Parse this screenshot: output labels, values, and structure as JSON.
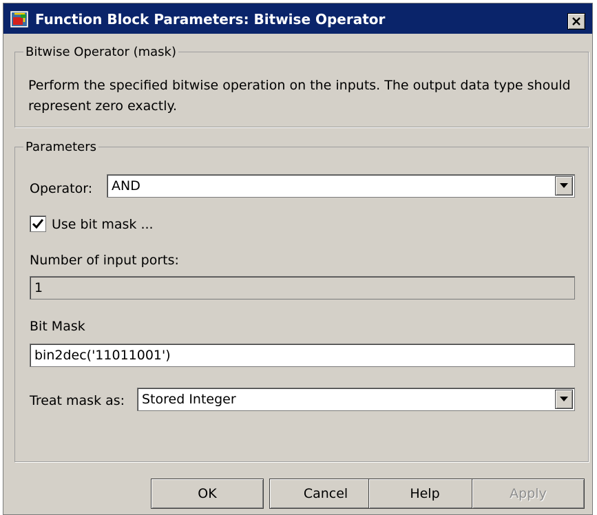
{
  "window": {
    "title": "Function Block Parameters: Bitwise Operator",
    "close_icon": "close-icon"
  },
  "mask_group": {
    "legend": "Bitwise Operator (mask)",
    "description": "Perform the specified bitwise operation on the inputs. The output data type should represent zero exactly."
  },
  "params_group": {
    "legend": "Parameters",
    "operator": {
      "label": "Operator:",
      "value": "AND"
    },
    "use_bit_mask": {
      "label": "Use bit mask ...",
      "checked": true
    },
    "num_inputs": {
      "label": "Number of input ports:",
      "value": "1"
    },
    "bit_mask": {
      "label": "Bit Mask",
      "value": "bin2dec('11011001')"
    },
    "treat_mask": {
      "label": "Treat mask as:",
      "value": "Stored Integer"
    }
  },
  "buttons": {
    "ok": "OK",
    "cancel": "Cancel",
    "help": "Help",
    "apply": "Apply"
  },
  "colors": {
    "titlebar": "#0a246a",
    "dialog_bg": "#d4d0c8",
    "disabled_text": "#8d8d8d"
  }
}
